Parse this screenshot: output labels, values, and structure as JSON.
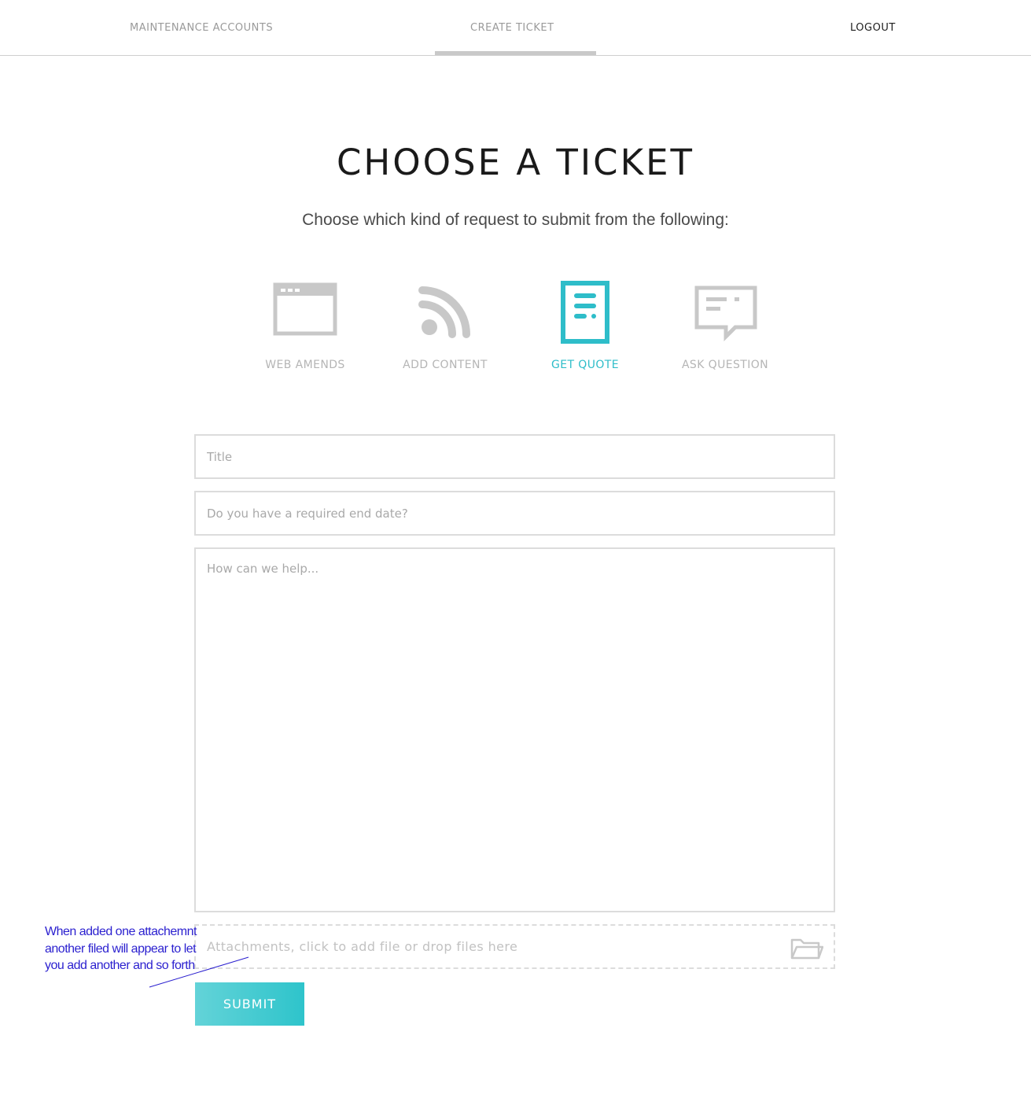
{
  "nav": {
    "maintenance_accounts": "MAINTENANCE ACCOUNTS",
    "create_ticket": "CREATE TICKET",
    "logout": "LOGOUT"
  },
  "heading": {
    "title": "CHOOSE A TICKET",
    "subtitle": "Choose which kind of request to submit from the following:"
  },
  "ticket_types": [
    {
      "label": "WEB AMENDS",
      "icon": "browser-window-icon",
      "active": false
    },
    {
      "label": "ADD CONTENT",
      "icon": "rss-feed-icon",
      "active": false
    },
    {
      "label": "GET QUOTE",
      "icon": "document-icon",
      "active": true
    },
    {
      "label": "ASK QUESTION",
      "icon": "speech-bubble-icon",
      "active": false
    }
  ],
  "form": {
    "title_placeholder": "Title",
    "date_placeholder": "Do you have a required end date?",
    "help_placeholder": "How can we help...",
    "attachments_text": "Attachments, click to add file or drop files here",
    "attachments_icon": "folder-open-icon",
    "submit_label": "SUBMIT"
  },
  "annotation": {
    "text": "When added one attachemnt another filed will appear to let you add another and so forth"
  },
  "colors": {
    "accent": "#2ebdc9",
    "inactive_icon": "#c8c8c8",
    "annotation": "#2a1fcf"
  }
}
